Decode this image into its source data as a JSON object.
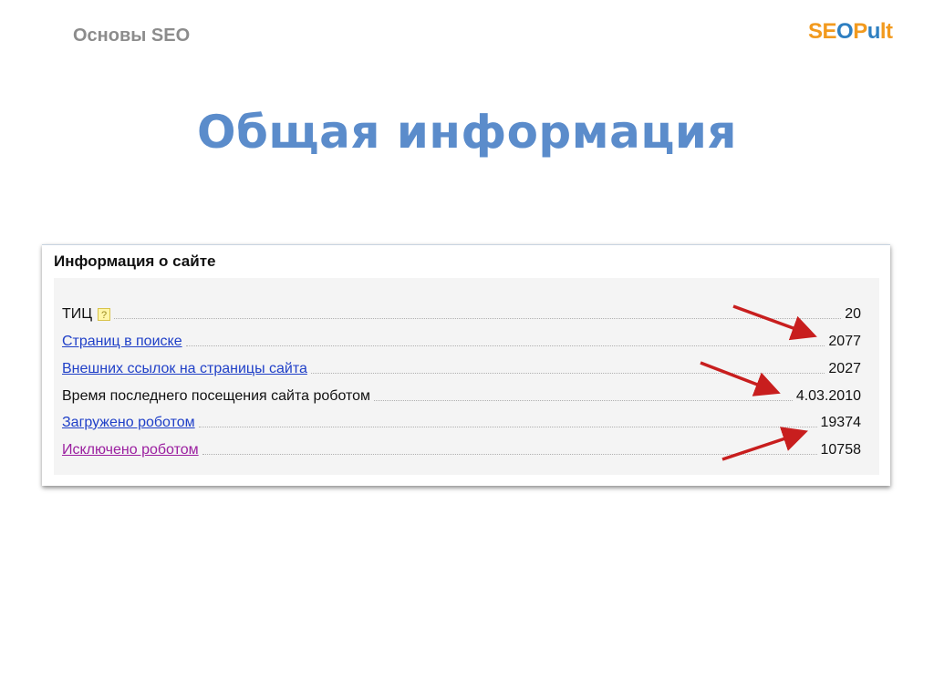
{
  "header": {
    "section_label": "Основы SEO",
    "logo_text": "SEOPult"
  },
  "slide": {
    "title": "Общая информация"
  },
  "panel": {
    "title": "Информация о сайте",
    "rows": [
      {
        "label": "ТИЦ",
        "value": "20",
        "style": "plain",
        "help": true
      },
      {
        "label": "Страниц в поиске",
        "value": "2077",
        "style": "link"
      },
      {
        "label": "Внешних ссылок на страницы сайта",
        "value": "2027",
        "style": "link"
      },
      {
        "label": "Время последнего посещения сайта роботом",
        "value": "4.03.2010",
        "style": "plain"
      },
      {
        "label": "Загружено роботом",
        "value": "19374",
        "style": "link"
      },
      {
        "label": "Исключено роботом",
        "value": "10758",
        "style": "visited"
      }
    ]
  },
  "colors": {
    "title": "#5b8ccb",
    "link": "#2040c8",
    "visited_link": "#9b1fa0",
    "arrow": "#c81e1e",
    "logo_orange": "#f29a1e",
    "logo_blue": "#2e7fc1"
  },
  "icons": {
    "help": "question-mark-icon",
    "logo": "seopult-logo"
  }
}
